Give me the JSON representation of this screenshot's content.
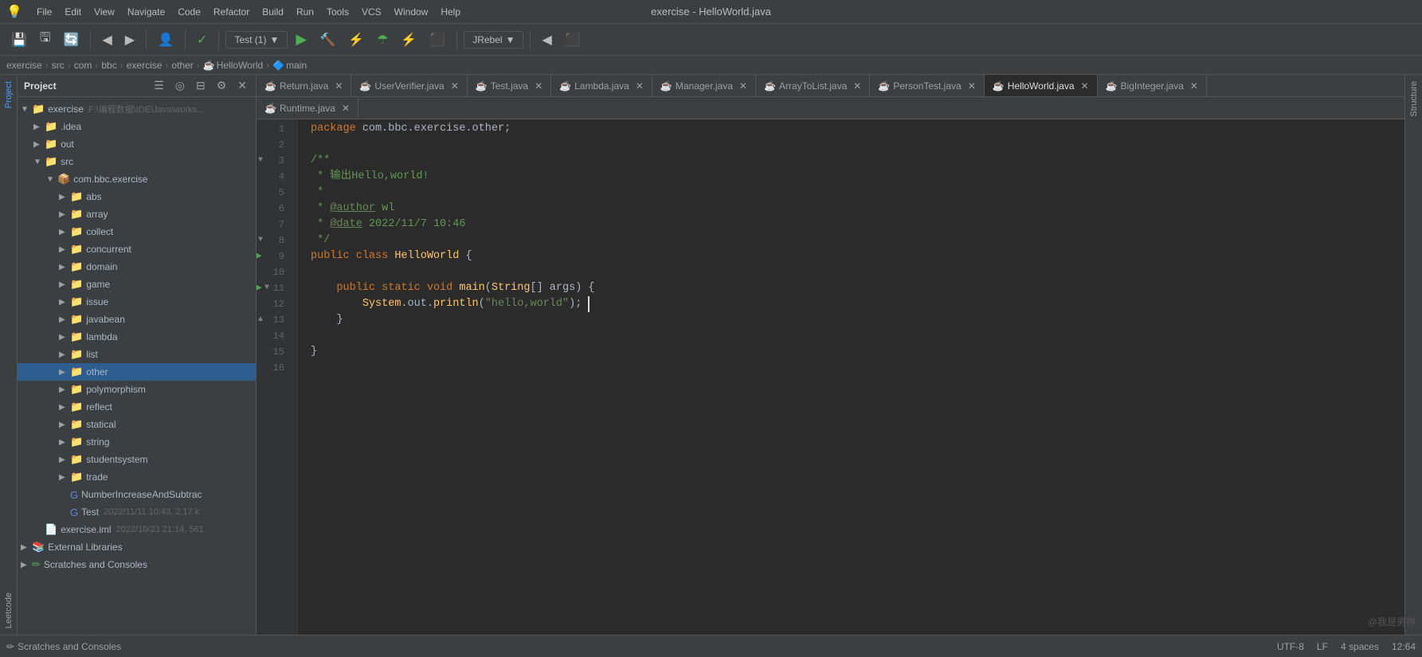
{
  "titleBar": {
    "title": "exercise - HelloWorld.java",
    "menuItems": [
      "File",
      "Edit",
      "View",
      "Navigate",
      "Code",
      "Refactor",
      "Build",
      "Run",
      "Tools",
      "VCS",
      "Window",
      "Help"
    ]
  },
  "toolbar": {
    "runConfig": "Test (1)",
    "jrebel": "JRebel"
  },
  "breadcrumb": {
    "items": [
      "exercise",
      "src",
      "com",
      "bbc",
      "exercise",
      "other",
      "HelloWorld",
      "main"
    ]
  },
  "projectPanel": {
    "title": "Project",
    "rootName": "exercise",
    "rootPath": "F:\\编程数据\\IDE\\Java\\works...",
    "items": [
      {
        "name": ".idea",
        "type": "folder",
        "level": 1,
        "collapsed": true
      },
      {
        "name": "out",
        "type": "folder",
        "level": 1,
        "collapsed": true
      },
      {
        "name": "src",
        "type": "folder",
        "level": 1,
        "collapsed": false
      },
      {
        "name": "com.bbc.exercise",
        "type": "package",
        "level": 2,
        "collapsed": false
      },
      {
        "name": "abs",
        "type": "folder",
        "level": 3,
        "collapsed": true
      },
      {
        "name": "array",
        "type": "folder",
        "level": 3,
        "collapsed": true
      },
      {
        "name": "collect",
        "type": "folder",
        "level": 3,
        "collapsed": true
      },
      {
        "name": "concurrent",
        "type": "folder",
        "level": 3,
        "collapsed": true
      },
      {
        "name": "domain",
        "type": "folder",
        "level": 3,
        "collapsed": true
      },
      {
        "name": "game",
        "type": "folder",
        "level": 3,
        "collapsed": true
      },
      {
        "name": "issue",
        "type": "folder",
        "level": 3,
        "collapsed": true
      },
      {
        "name": "javabean",
        "type": "folder",
        "level": 3,
        "collapsed": true
      },
      {
        "name": "lambda",
        "type": "folder",
        "level": 3,
        "collapsed": true
      },
      {
        "name": "list",
        "type": "folder",
        "level": 3,
        "collapsed": true
      },
      {
        "name": "other",
        "type": "folder",
        "level": 3,
        "collapsed": true,
        "selected": true
      },
      {
        "name": "polymorphism",
        "type": "folder",
        "level": 3,
        "collapsed": true
      },
      {
        "name": "reflect",
        "type": "folder",
        "level": 3,
        "collapsed": true
      },
      {
        "name": "statical",
        "type": "folder",
        "level": 3,
        "collapsed": true
      },
      {
        "name": "string",
        "type": "folder",
        "level": 3,
        "collapsed": true
      },
      {
        "name": "studentsystem",
        "type": "folder",
        "level": 3,
        "collapsed": true
      },
      {
        "name": "trade",
        "type": "folder",
        "level": 3,
        "collapsed": true
      },
      {
        "name": "NumberIncreaseAndSubtrac",
        "type": "java",
        "level": 3,
        "collapsed": true
      },
      {
        "name": "Test",
        "type": "java",
        "level": 3,
        "info": "2022/11/11 10:43, 2.17 k"
      },
      {
        "name": "exercise.iml",
        "type": "iml",
        "level": 1,
        "info": "2022/10/23 21:14, 561"
      },
      {
        "name": "External Libraries",
        "type": "lib",
        "level": 0,
        "collapsed": true
      },
      {
        "name": "Scratches and Consoles",
        "type": "scratches",
        "level": 0,
        "collapsed": true
      }
    ]
  },
  "editorTabs": [
    {
      "name": "Return.java",
      "type": "java",
      "active": false,
      "modified": false
    },
    {
      "name": "UserVerifier.java",
      "type": "java",
      "active": false,
      "modified": false
    },
    {
      "name": "Test.java",
      "type": "java",
      "active": false,
      "modified": false
    },
    {
      "name": "Lambda.java",
      "type": "java",
      "active": false,
      "modified": false
    },
    {
      "name": "Manager.java",
      "type": "java",
      "active": false,
      "modified": false
    },
    {
      "name": "ArrayToList.java",
      "type": "java",
      "active": false,
      "modified": false
    },
    {
      "name": "PersonTest.java",
      "type": "java",
      "active": false,
      "modified": false
    },
    {
      "name": "HelloWorld.java",
      "type": "java",
      "active": true,
      "modified": false
    },
    {
      "name": "BigInteger.java",
      "type": "java",
      "active": false,
      "modified": false
    },
    {
      "name": "Runtime.java",
      "type": "java",
      "active": false,
      "modified": false
    }
  ],
  "codeLines": [
    {
      "num": 1,
      "content": "package com.bbc.exercise.other;"
    },
    {
      "num": 2,
      "content": ""
    },
    {
      "num": 3,
      "content": "/**"
    },
    {
      "num": 4,
      "content": " * 输出Hello,world!"
    },
    {
      "num": 5,
      "content": " *"
    },
    {
      "num": 6,
      "content": " * @author wl"
    },
    {
      "num": 7,
      "content": " * @date 2022/11/7 10:46"
    },
    {
      "num": 8,
      "content": " */"
    },
    {
      "num": 9,
      "content": "public class HelloWorld {"
    },
    {
      "num": 10,
      "content": ""
    },
    {
      "num": 11,
      "content": "    public static void main(String[] args) {"
    },
    {
      "num": 12,
      "content": "        System.out.println(\"hello,world\");"
    },
    {
      "num": 13,
      "content": "    }"
    },
    {
      "num": 14,
      "content": ""
    },
    {
      "num": 15,
      "content": "}"
    },
    {
      "num": 16,
      "content": ""
    }
  ],
  "bottomBar": {
    "scratches": "Scratches and Consoles",
    "watermark": "@我是男神"
  },
  "sideIcons": {
    "left": [
      "Project",
      "Leetcode"
    ],
    "right": [
      "Structure"
    ]
  }
}
